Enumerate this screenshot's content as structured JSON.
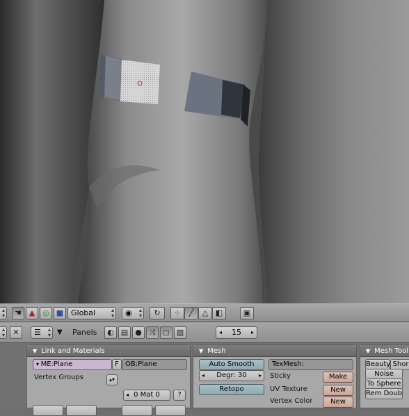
{
  "view_header": {
    "orientation": "Global",
    "icons": [
      "hand-icon",
      "rotate-manipulator-icon",
      "scale-manipulator-icon",
      "translate-manipulator-icon",
      "pivot-icon",
      "snap-icon",
      "vertex-select-icon",
      "edge-select-icon",
      "face-select-icon",
      "occlude-icon",
      "render-icon"
    ]
  },
  "buttons_header": {
    "panels_label": "Panels",
    "frame": "15"
  },
  "link_materials": {
    "title": "Link and Materials",
    "mesh_name": "ME:Plane",
    "f_label": "F",
    "object_name": "OB:Plane",
    "vertex_groups_label": "Vertex Groups",
    "mat_label": "0 Mat 0",
    "help_label": "?"
  },
  "mesh_panel": {
    "title": "Mesh",
    "auto_smooth": "Auto Smooth",
    "degr": "Degr: 30",
    "retopo": "Retopo",
    "texmesh": "TexMesh:",
    "sticky": "Sticky",
    "make": "Make",
    "uv_texture": "UV Texture",
    "uv_new": "New",
    "vertex_color": "Vertex Color",
    "vc_new": "New"
  },
  "mesh_tools": {
    "title": "Mesh Tool",
    "beauty": "Beauty",
    "short": "Shor",
    "noise": "Noise",
    "to_sphere": "To Sphere",
    "rem_doubl": "Rem Doubl"
  }
}
